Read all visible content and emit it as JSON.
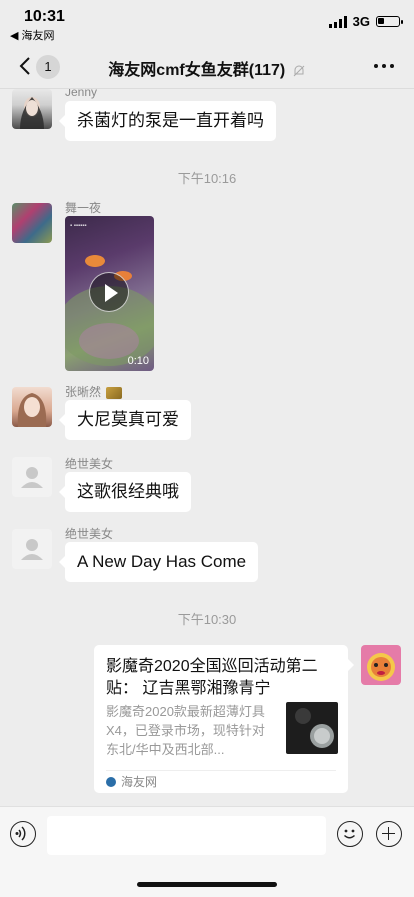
{
  "status_bar": {
    "time": "10:31",
    "back_app": "◀ 海友网",
    "network": "3G",
    "battery_level": 0.3
  },
  "nav": {
    "back_badge": "1",
    "title": "海友网cmf女鱼友群(117)",
    "icons": {
      "back": "chevron-left-icon",
      "mute": "bell-off-icon",
      "more": "more-icon"
    }
  },
  "messages": [
    {
      "sender": "Jenny",
      "text": "杀菌灯的泵是一直开着吗"
    },
    {
      "timestamp": "下午10:16"
    },
    {
      "sender": "舞一夜",
      "video_duration": "0:10"
    },
    {
      "sender": "张晰然",
      "text": "大尼莫真可爱"
    },
    {
      "sender": "绝世美女",
      "text": "这歌很经典哦"
    },
    {
      "sender": "绝世美女",
      "text": "A New Day Has Come"
    },
    {
      "timestamp": "下午10:30"
    },
    {
      "link_card": {
        "title": "影魔奇2020全国巡回活动第二贴： 辽吉黑鄂湘豫青宁",
        "description": "影魔奇2020款最新超薄灯具X4，已登录市场，现特针对东北/华中及西北部...",
        "source": "海友网"
      }
    }
  ],
  "input_bar": {
    "icons": {
      "voice": "voice-icon",
      "emoji": "emoji-icon",
      "more": "plus-icon"
    }
  }
}
